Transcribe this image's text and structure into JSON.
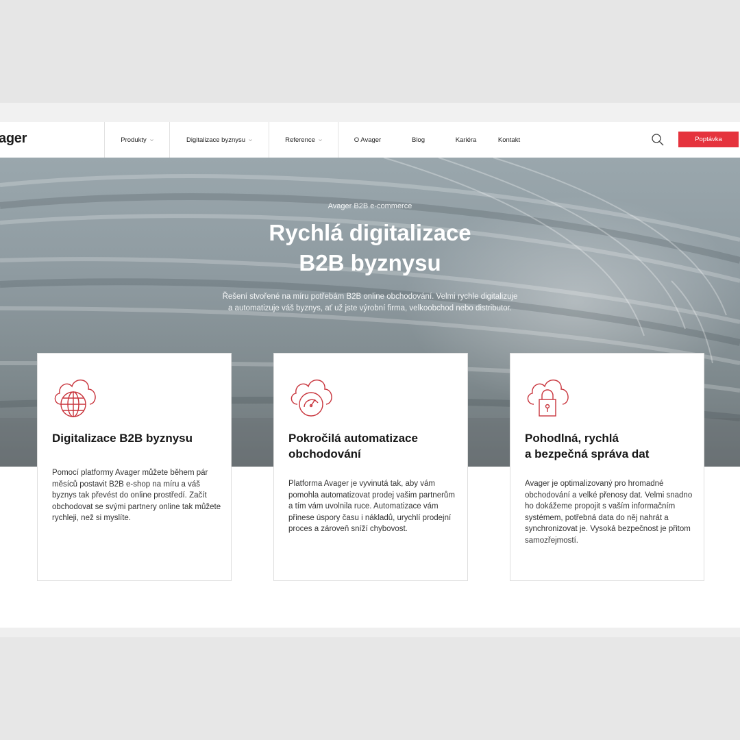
{
  "header": {
    "logo": "ager",
    "nav": [
      {
        "label": "Produkty",
        "dropdown": true
      },
      {
        "label": "Digitalizace byznysu",
        "dropdown": true
      },
      {
        "label": "Reference",
        "dropdown": true
      },
      {
        "label": "O Avager",
        "dropdown": false
      },
      {
        "label": "Blog",
        "dropdown": false
      },
      {
        "label": "Kariéra",
        "dropdown": false
      },
      {
        "label": "Kontakt",
        "dropdown": false
      }
    ],
    "search_icon": "search-icon",
    "cta_label": "Poptávka",
    "cta_color": "#e5333d"
  },
  "hero": {
    "kicker": "Avager B2B e-commerce",
    "title_line1": "Rychlá digitalizace",
    "title_line2": "B2B byznysu",
    "text_line1": "Řešení stvořené na míru potřebám B2B online obchodování. Velmi rychle digitalizuje",
    "text_line2": "a automatizuje váš byznys, ať už jste výrobní firma, velkoobchod nebo distributor."
  },
  "cards": [
    {
      "icon": "cloud-globe-icon",
      "title_line1": "Digitalizace B2B byznysu",
      "title_line2": "",
      "text": "Pomocí platformy Avager můžete během pár měsíců postavit B2B e-shop na míru a váš byznys tak převést do online prostředí. Začít obchodovat se svými partnery online tak můžete rychleji, než si myslíte."
    },
    {
      "icon": "cloud-gauge-icon",
      "title_line1": "Pokročilá automatizace",
      "title_line2": "obchodování",
      "text": "Platforma Avager je vyvinutá tak, aby vám pomohla automatizovat prodej vašim partnerům a tím vám uvolnila ruce. Automatizace vám přinese úspory času i nákladů, urychlí prodejní proces a zároveň sníží chybovost."
    },
    {
      "icon": "cloud-lock-icon",
      "title_line1": "Pohodlná, rychlá",
      "title_line2": "a bezpečná správa dat",
      "text": "Avager je optimalizovaný pro hromadné obchodování a velké přenosy dat. Velmi snadno ho dokážeme propojit s vaším informačním systémem, potřebná data do něj nahrát a synchronizovat je. Vysoká bezpečnost je přitom samozřejmostí."
    }
  ],
  "colors": {
    "accent": "#e5333d",
    "icon_stroke": "#c8333b"
  }
}
